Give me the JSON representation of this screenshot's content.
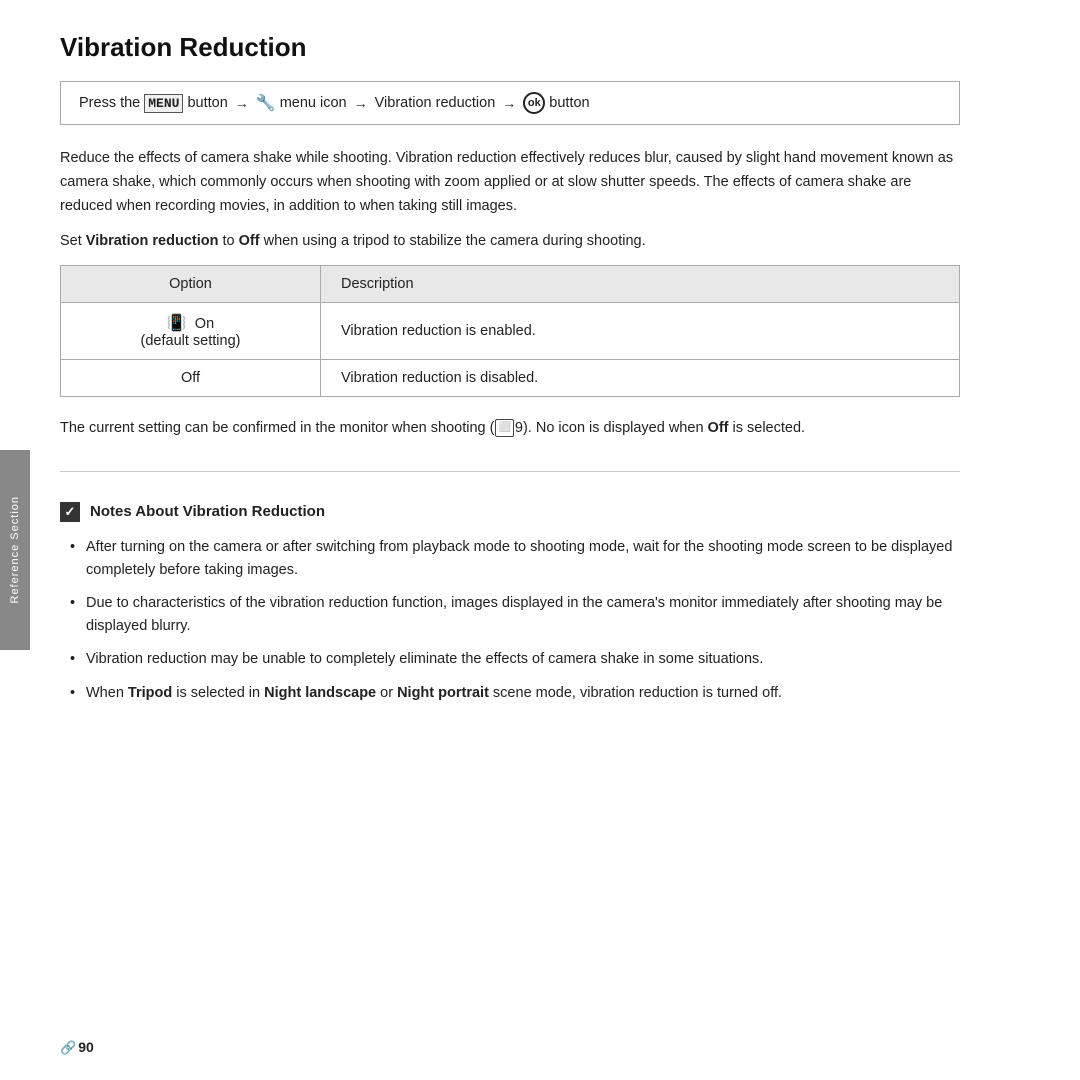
{
  "page": {
    "title": "Vibration Reduction",
    "nav": {
      "prefix": "Press the",
      "menu_word": "MENU",
      "button_label": "button",
      "parts": [
        "menu icon",
        "Vibration reduction",
        "button"
      ]
    },
    "description": "Reduce the effects of camera shake while shooting. Vibration reduction effectively reduces blur, caused by slight hand movement known as camera shake, which commonly occurs when shooting with zoom applied or at slow shutter speeds. The effects of camera shake are reduced when recording movies, in addition to when taking still images.",
    "set_line": "Set Vibration reduction to Off when using a tripod to stabilize the camera during shooting.",
    "table": {
      "col1_header": "Option",
      "col2_header": "Description",
      "rows": [
        {
          "option": "On\n(default setting)",
          "description": "Vibration reduction is enabled."
        },
        {
          "option": "Off",
          "description": "Vibration reduction is disabled."
        }
      ]
    },
    "confirm_text1": "The current setting can be confirmed in the monitor when shooting (",
    "confirm_ref": "9",
    "confirm_text2": "). No icon is displayed when ",
    "confirm_bold": "Off",
    "confirm_text3": " is selected.",
    "notes_header": "Notes About Vibration Reduction",
    "notes": [
      "After turning on the camera or after switching from playback mode to shooting mode, wait for the shooting mode screen to be displayed completely before taking images.",
      "Due to characteristics of the vibration reduction function, images displayed in the camera's monitor immediately after shooting may be displayed blurry.",
      "Vibration reduction may be unable to completely eliminate the effects of camera shake in some situations.",
      "When Tripod is selected in Night landscape or Night portrait scene mode, vibration reduction is turned off."
    ],
    "sidebar_label": "Reference Section",
    "footer_page": "90"
  }
}
